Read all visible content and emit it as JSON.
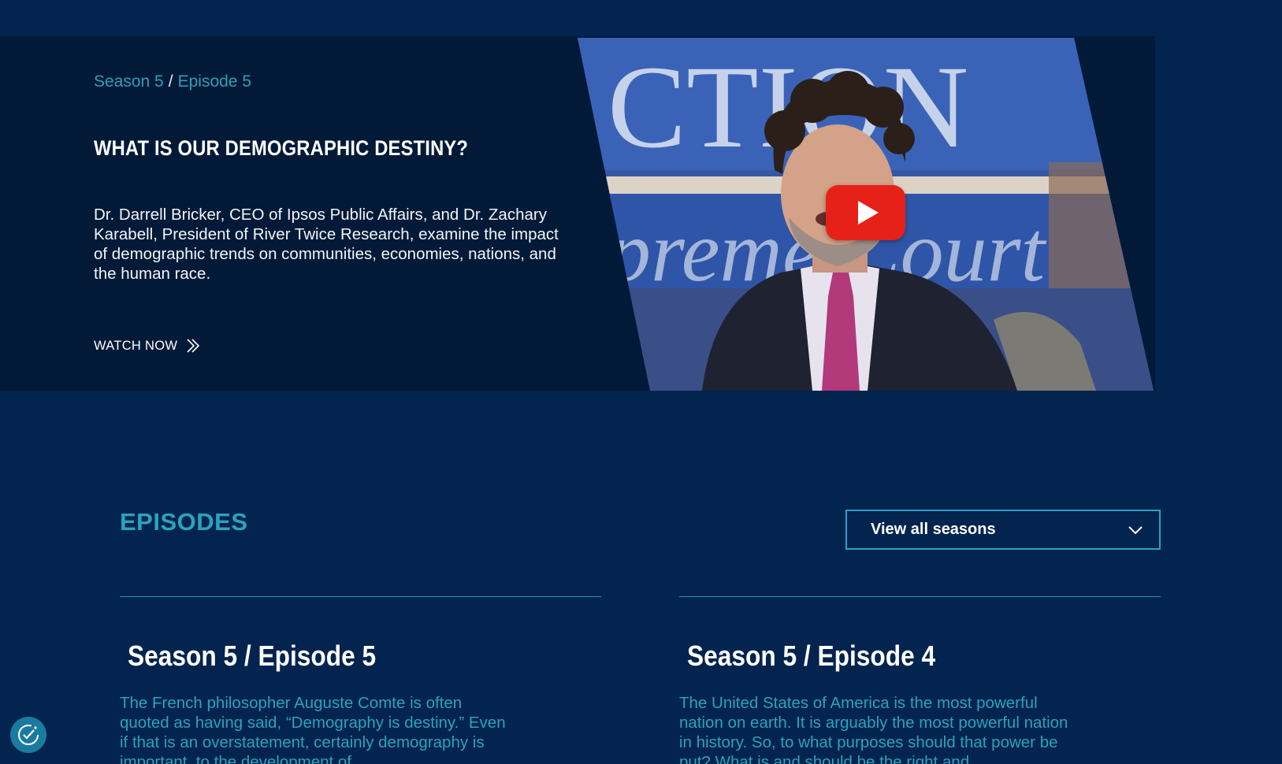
{
  "hero": {
    "breadcrumb": {
      "season": "Season 5",
      "separator": "/",
      "episode": "Episode 5"
    },
    "title": "WHAT IS OUR DEMOGRAPHIC DESTINY?",
    "description": "Dr. Darrell Bricker, CEO of Ipsos Public Affairs, and Dr. Zachary Karabell, President of River Twice Research, examine the impact of demographic trends on communities, economies, nations, and the human race.",
    "watch_label": "WATCH NOW",
    "video_backdrop_text": "CTION",
    "video_backdrop_text2": "preme Court"
  },
  "episodes": {
    "section_title": "EPISODES",
    "season_select": {
      "selected": "View all seasons"
    },
    "cards": [
      {
        "heading": "Season 5 / Episode 5",
        "text": "The French philosopher Auguste Comte is often quoted as having said, “Demography is destiny.” Even if that is an overstatement, certainly demography is important, to the development of"
      },
      {
        "heading": "Season 5 / Episode 4",
        "text": "The United States of America is the most powerful nation on earth. It is arguably the most powerful nation in history. So, to what purposes should that power be put? What is and should be the right and"
      }
    ]
  },
  "colors": {
    "page_bg": "#02244f",
    "hero_bg": "#021a38",
    "accent": "#2aa3be",
    "play_red": "#e62117"
  },
  "icons": {
    "watch": "double-chevron-right-icon",
    "select": "chevron-down-icon",
    "play": "play-icon",
    "cookie": "cookie-consent-icon"
  }
}
